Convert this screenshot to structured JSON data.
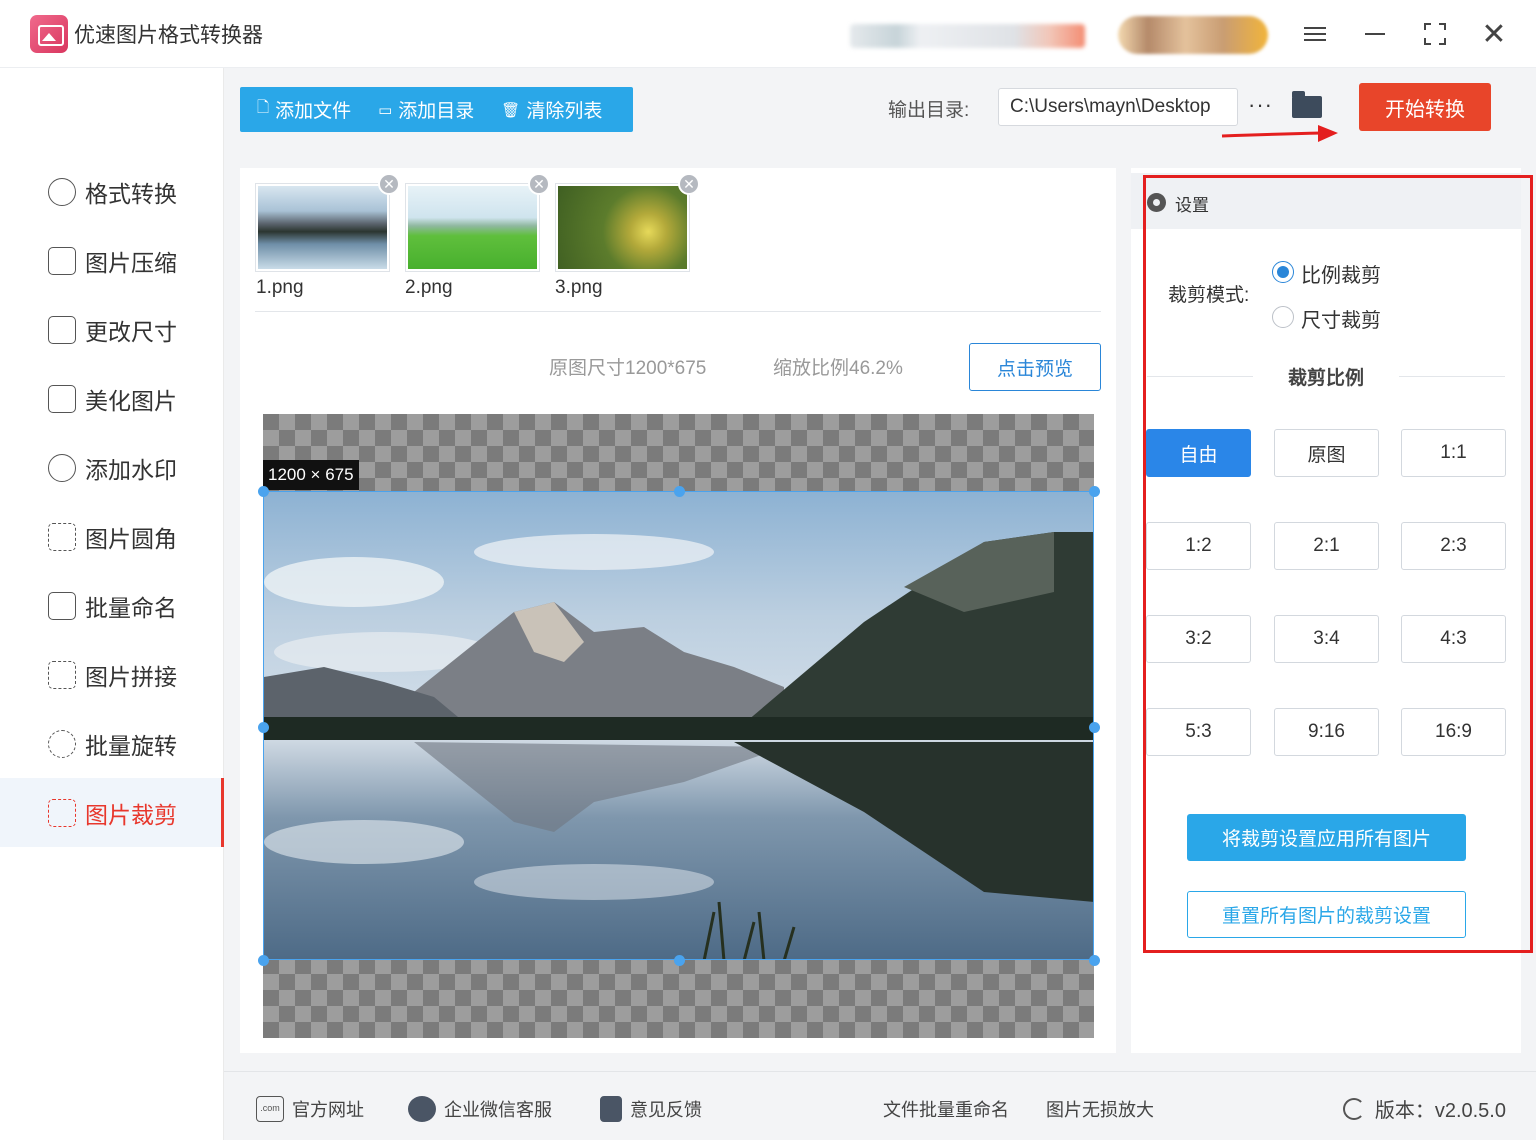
{
  "app": {
    "title": "优速图片格式转换器"
  },
  "sidebar": {
    "items": [
      {
        "label": "格式转换",
        "icon": "format-convert-icon"
      },
      {
        "label": "图片压缩",
        "icon": "compress-icon"
      },
      {
        "label": "更改尺寸",
        "icon": "resize-icon"
      },
      {
        "label": "美化图片",
        "icon": "beautify-icon"
      },
      {
        "label": "添加水印",
        "icon": "watermark-icon"
      },
      {
        "label": "图片圆角",
        "icon": "round-corner-icon"
      },
      {
        "label": "批量命名",
        "icon": "rename-icon"
      },
      {
        "label": "图片拼接",
        "icon": "stitch-icon"
      },
      {
        "label": "批量旋转",
        "icon": "rotate-icon"
      },
      {
        "label": "图片裁剪",
        "icon": "crop-icon",
        "active": true
      }
    ]
  },
  "toolbar": {
    "add_file": "添加文件",
    "add_dir": "添加目录",
    "clear_list": "清除列表",
    "output_label": "输出目录:",
    "output_path": "C:\\Users\\mayn\\Desktop",
    "more": "···",
    "start": "开始转换"
  },
  "files": [
    {
      "name": "1.png"
    },
    {
      "name": "2.png"
    },
    {
      "name": "3.png"
    }
  ],
  "preview": {
    "orig_size": "原图尺寸1200*675",
    "scale": "缩放比例46.2%",
    "preview_btn": "点击预览",
    "crop_size": "1200 × 675"
  },
  "settings": {
    "title": "设置",
    "crop_mode_label": "裁剪模式:",
    "mode_ratio": "比例裁剪",
    "mode_size": "尺寸裁剪",
    "selected_mode": "比例裁剪",
    "ratio_title": "裁剪比例",
    "ratios": [
      "自由",
      "原图",
      "1:1",
      "1:2",
      "2:1",
      "2:3",
      "3:2",
      "3:4",
      "4:3",
      "5:3",
      "9:16",
      "16:9"
    ],
    "selected_ratio": "自由",
    "apply_all": "将裁剪设置应用所有图片",
    "reset_all": "重置所有图片的裁剪设置"
  },
  "footer": {
    "website": "官方网址",
    "wechat": "企业微信客服",
    "feedback": "意见反馈",
    "batch_rename": "文件批量重命名",
    "lossless": "图片无损放大",
    "version": "版本：v2.0.5.0"
  },
  "colors": {
    "accent": "#2aa7e8",
    "start_button": "#e8452a",
    "active_nav": "#e8372c",
    "highlight_frame": "#e41f1f"
  }
}
